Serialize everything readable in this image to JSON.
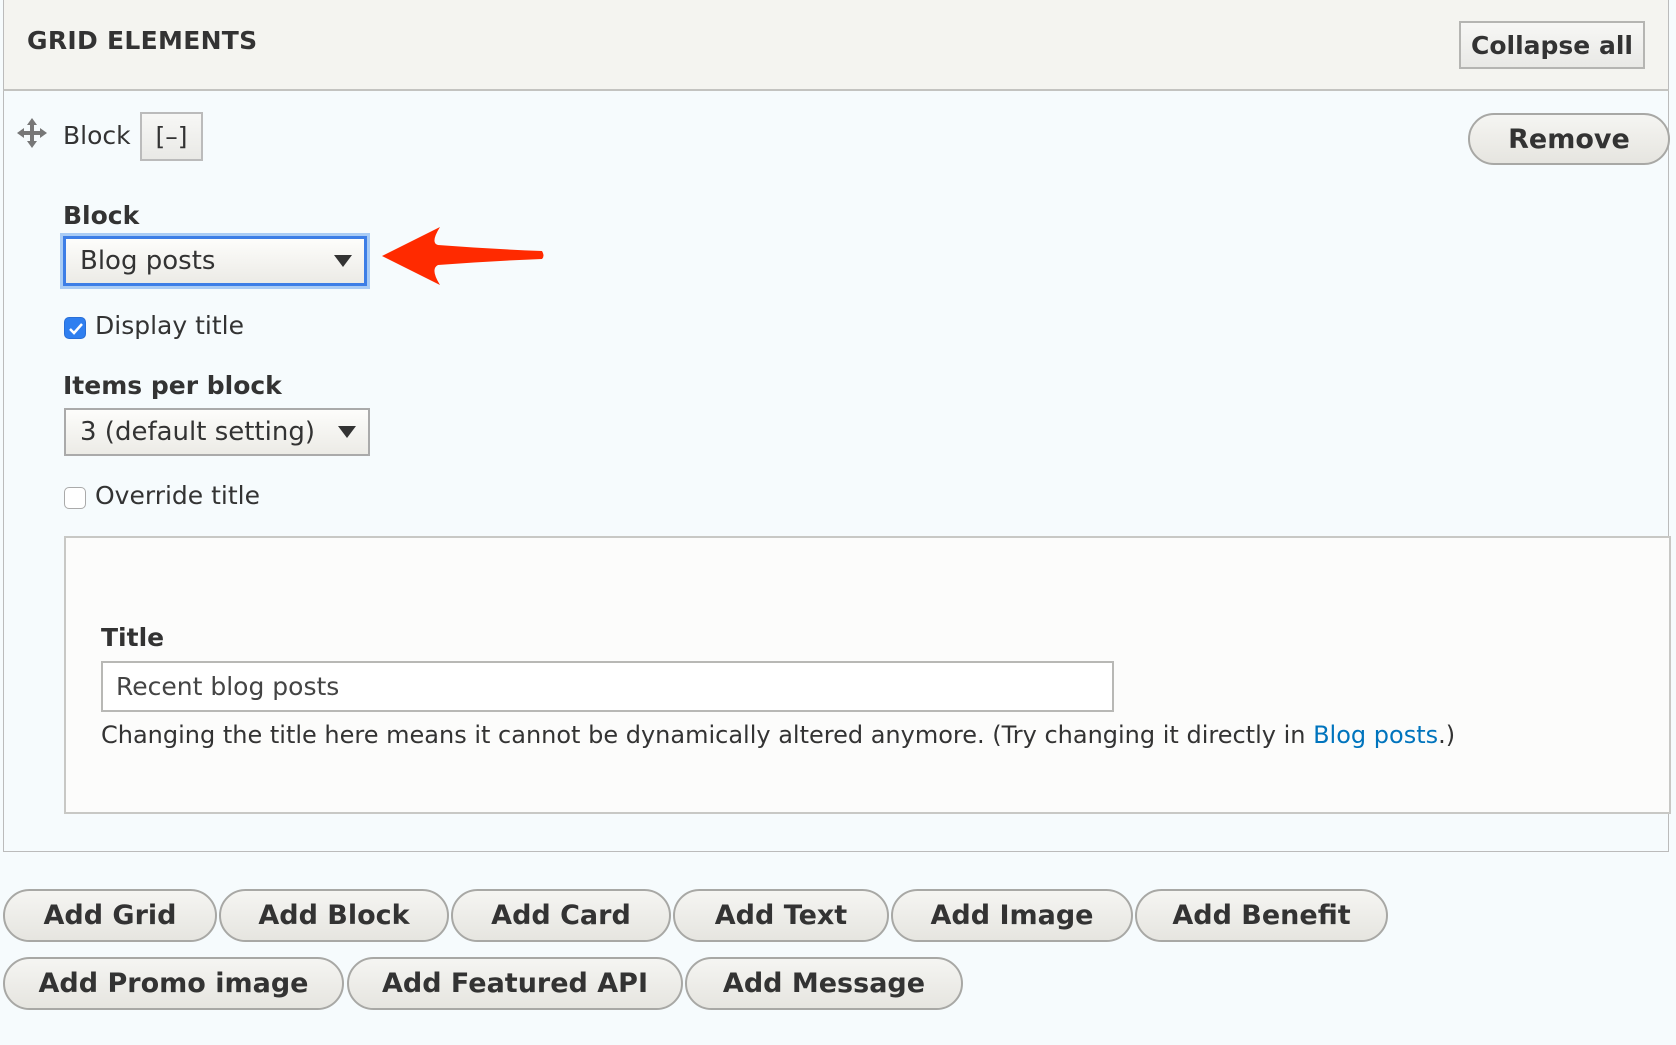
{
  "header": {
    "title": "GRID ELEMENTS",
    "collapse_all_label": "Collapse all"
  },
  "item": {
    "type_label": "Block",
    "toggle_label": "[–]",
    "remove_label": "Remove",
    "block_field": {
      "label": "Block",
      "value": "Blog posts"
    },
    "display_title": {
      "label": "Display title",
      "checked": true
    },
    "items_per_block": {
      "label": "Items per block",
      "value": "3 (default setting)"
    },
    "override_title": {
      "label": "Override title",
      "checked": false
    },
    "title_field": {
      "label": "Title",
      "value": "Recent blog posts",
      "description_before": "Changing the title here means it cannot be dynamically altered anymore. (Try changing it directly in ",
      "description_link": "Blog posts",
      "description_after": ".)"
    }
  },
  "add_buttons": [
    "Add Grid",
    "Add Block",
    "Add Card",
    "Add Text",
    "Add Image",
    "Add Benefit",
    "Add Promo image",
    "Add Featured API",
    "Add Message"
  ],
  "colors": {
    "accent": "#3d7ee6",
    "link": "#0074bd",
    "annotation_arrow": "#ff2a00",
    "checkbox_checked": "#2f7ff0"
  }
}
